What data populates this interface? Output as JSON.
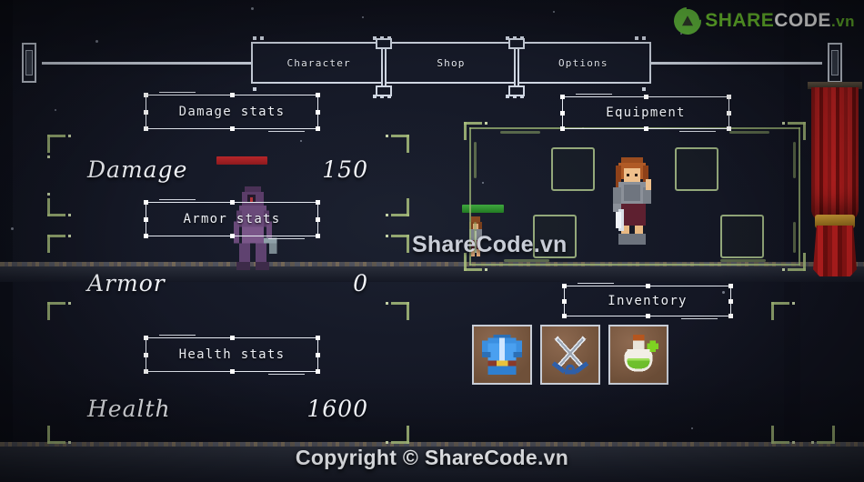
{
  "brand": {
    "logo_share": "SHARE",
    "logo_code": "CODE",
    "logo_tld": ".vn",
    "logo_icon": "sharecode-circle-icon",
    "watermark_center": "ShareCode.vn",
    "watermark_bottom": "Copyright © ShareCode.vn",
    "accent_green": "#6cc22f",
    "white": "#ffffff"
  },
  "navbar": {
    "items": [
      {
        "label": "Character"
      },
      {
        "label": "Shop"
      },
      {
        "label": "Options"
      }
    ]
  },
  "panels": {
    "damage_stats": "Damage stats",
    "armor_stats": "Armor stats",
    "health_stats": "Health stats",
    "equipment": "Equipment",
    "inventory": "Inventory"
  },
  "stats": [
    {
      "name": "Damage",
      "value": "150"
    },
    {
      "name": "Armor",
      "value": "0"
    },
    {
      "name": "Health",
      "value": "1600"
    }
  ],
  "bars": {
    "enemy_health_color": "#b8262a",
    "player_health_color": "#3fa83f"
  },
  "equipment_slots": [
    {
      "slot": "equipment-slot-1",
      "item": ""
    },
    {
      "slot": "equipment-slot-2",
      "item": ""
    },
    {
      "slot": "equipment-slot-3",
      "item": ""
    },
    {
      "slot": "equipment-slot-4",
      "item": ""
    }
  ],
  "inventory_items": [
    {
      "icon": "blue-tunic-armor-icon",
      "label": ""
    },
    {
      "icon": "crossed-swords-icon",
      "label": ""
    },
    {
      "icon": "green-health-potion-icon",
      "label": ""
    }
  ],
  "sprites": {
    "player": "player-warrior-sprite",
    "enemy": "purple-hooded-enemy-sprite",
    "player_mini": "player-mini-sprite"
  },
  "scenery": {
    "curtain": "red-curtain",
    "brackets": "green-corner-bracket"
  }
}
